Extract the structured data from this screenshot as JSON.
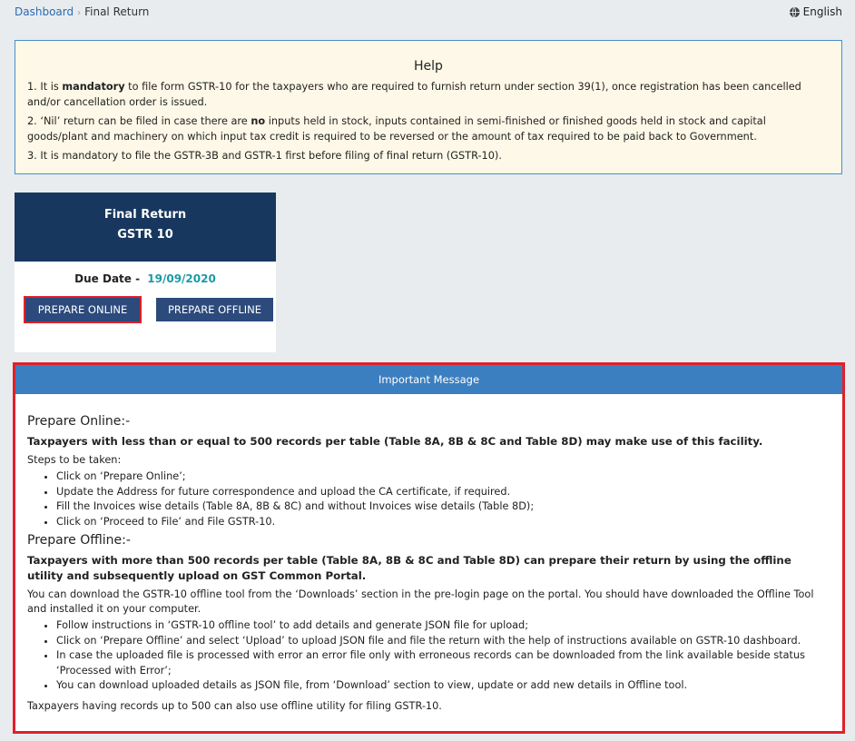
{
  "breadcrumb": {
    "home": "Dashboard",
    "current": "Final Return"
  },
  "language": {
    "label": "English",
    "icon": "globe-icon"
  },
  "help": {
    "title": "Help",
    "items": [
      {
        "pre": "1. It is ",
        "bold": "mandatory",
        "post": " to file form GSTR-10 for the taxpayers who are required to furnish return under section 39(1), once registration has been cancelled and/or cancellation order is issued."
      },
      {
        "pre": "2. ‘Nil’ return can be filed in case there are ",
        "bold": "no",
        "post": " inputs held in stock, inputs contained in semi-finished or finished goods held in stock and capital goods/plant and machinery on which input tax credit is required to be reversed or the amount of tax required to be paid back to Government."
      },
      {
        "pre": "3. It is mandatory to file the GSTR-3B and GSTR-1 first before filing of final return (GSTR-10).",
        "bold": "",
        "post": ""
      }
    ]
  },
  "card": {
    "title": "Final Return",
    "subtitle": "GSTR 10",
    "due_label": "Due Date -",
    "due_date": "19/09/2020",
    "prepare_online": "PREPARE ONLINE",
    "prepare_offline": "PREPARE OFFLINE"
  },
  "important": {
    "header": "Important Message",
    "online": {
      "heading": "Prepare Online:-",
      "bold": "Taxpayers with less than or equal to 500 records per table (Table 8A, 8B & 8C and Table 8D) may make use of this facility.",
      "steps_label": "Steps to be taken:",
      "steps": [
        "Click on ‘Prepare Online’;",
        "Update the Address for future correspondence and upload the CA certificate, if required.",
        "Fill the Invoices wise details (Table 8A, 8B & 8C) and without Invoices wise details (Table 8D);",
        "Click on ‘Proceed to File’ and File GSTR-10."
      ]
    },
    "offline": {
      "heading": "Prepare Offline:-",
      "bold": "Taxpayers with more than 500 records per table (Table 8A, 8B & 8C and Table 8D) can prepare their return by using the offline utility and subsequently upload on GST Common Portal.",
      "intro": "You can download the GSTR-10 offline tool from the ‘Downloads’ section in the pre-login page on the portal. You should have downloaded the Offline Tool and installed it on your computer.",
      "steps": [
        "Follow instructions in ‘GSTR-10 offline tool’ to add details and generate JSON file for upload;",
        "Click on ‘Prepare Offline’ and select ‘Upload’ to upload JSON file and file the return with the help of instructions available on GSTR-10 dashboard.",
        "In case the uploaded file is processed with error an error file only with erroneous records can be downloaded from the link available beside status ‘Processed with Error’;",
        "You can download uploaded details as JSON file, from ‘Download’ section to view, update or add new details in Offline tool."
      ],
      "footer": "Taxpayers having records up to 500 can also use offline utility for filing GSTR-10."
    }
  },
  "colors": {
    "header_navy": "#17375e",
    "button_blue": "#2c4a7c",
    "message_header": "#3b7fc0",
    "highlight_red": "#e0202a",
    "due_date_teal": "#1a9aa6",
    "help_bg": "#fdf8e7"
  }
}
